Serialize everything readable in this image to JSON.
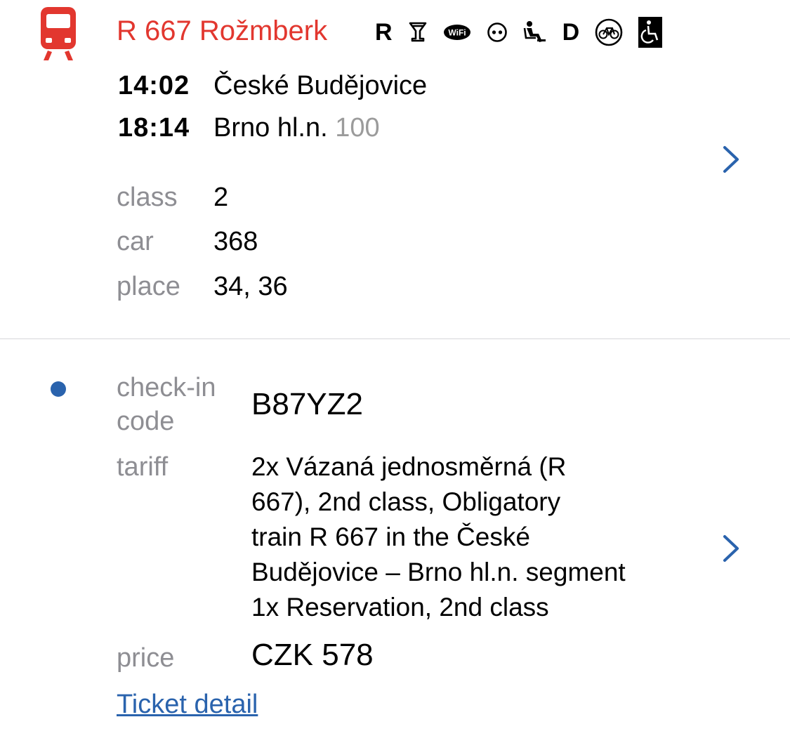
{
  "colors": {
    "train_red": "#e2372f",
    "link_blue": "#2a63ad",
    "label_gray": "#8e8e93"
  },
  "train": {
    "icon": "train-icon",
    "name": "R 667 Rožmberk",
    "amenities": [
      {
        "type": "letter",
        "text": "R",
        "icon": "reservation-letter"
      },
      {
        "type": "icon",
        "icon": "bistro-glass-icon"
      },
      {
        "type": "icon",
        "icon": "wifi-icon",
        "text": "WiFi"
      },
      {
        "type": "icon",
        "icon": "socket-icon"
      },
      {
        "type": "icon",
        "icon": "reserved-seat-icon"
      },
      {
        "type": "letter",
        "text": "D",
        "icon": "d-letter"
      },
      {
        "type": "icon",
        "icon": "bicycle-icon"
      },
      {
        "type": "icon",
        "icon": "wheelchair-icon"
      }
    ]
  },
  "journey": {
    "departure": {
      "time": "14:02",
      "station": "České Budějovice"
    },
    "arrival": {
      "time": "18:14",
      "station": "Brno hl.n.",
      "platform": "100"
    }
  },
  "seat": {
    "class_label": "class",
    "class_value": "2",
    "car_label": "car",
    "car_value": "368",
    "place_label": "place",
    "place_value": "34, 36"
  },
  "ticket": {
    "checkin_label_1": "check-in",
    "checkin_label_2": "code",
    "checkin_code": "B87YZ2",
    "tariff_label": "tariff",
    "tariff_lines": [
      "2x Vázaná jednosměrná (R",
      "667), 2nd class, Obligatory",
      "train R 667 in the České",
      "Budějovice – Brno hl.n. segment",
      "1x Reservation, 2nd class"
    ],
    "price_label": "price",
    "price_value": "CZK 578",
    "detail_link": "Ticket detail"
  }
}
